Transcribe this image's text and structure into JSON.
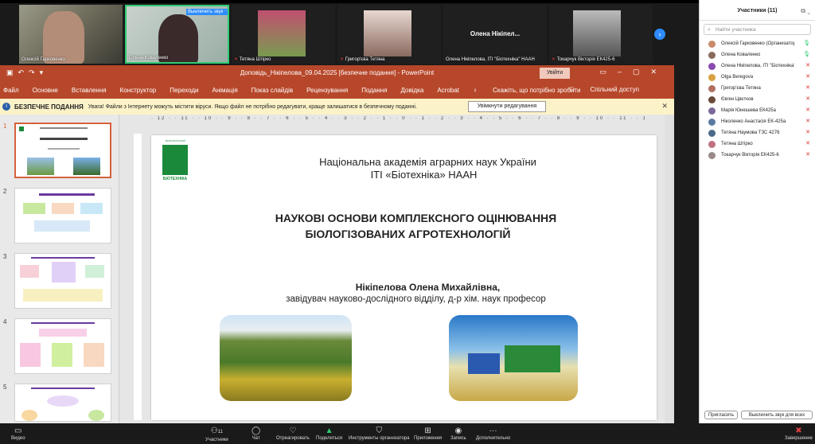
{
  "video_strip": {
    "tiles": [
      {
        "name": "Олексій Гарковенко",
        "muted": false
      },
      {
        "name": "Олена Коваленко",
        "badge": "Выключить звук",
        "muted": false
      },
      {
        "name": "Тетяна Штірко",
        "muted": true
      },
      {
        "name": "Григор'єва Тетяна",
        "muted": true
      },
      {
        "name": "Олена Нікіпелова, ІТІ \"Біотехніка\" НААН",
        "display": "Олена  Нікіпел...",
        "muted": false
      },
      {
        "name": "Токарчук Вікторія ЕК425-6",
        "muted": true
      }
    ],
    "next_icon": "chevron-right-icon"
  },
  "powerpoint": {
    "window_title": "Доповідь_Нікіпелова_09.04.2025 [безпечне подання] - PowerPoint",
    "sign_in": "Увійти",
    "ribbon_tabs": [
      "Файл",
      "Основне",
      "Вставлення",
      "Конструктор",
      "Переходи",
      "Анімація",
      "Показ слайдів",
      "Рецензування",
      "Подання",
      "Довідка",
      "Acrobat",
      "Скажіть, що потрібно зробити"
    ],
    "share": "Спільний доступ",
    "message_bar": {
      "title": "БЕЗПЕЧНЕ ПОДАННЯ",
      "text": "Увага! Файли з Інтернету можуть містити віруси. Якщо файл не потрібно редагувати, краще залишатися в безпечному поданні.",
      "button": "Увімкнути редагування"
    },
    "thumbnails": [
      "1",
      "2",
      "3",
      "4",
      "5"
    ],
    "ruler_numbers": "· 12 · · 11 · · 10 · · 9 · · 8 · · 7 · · 6 · · 5 · · 4 · · 3 · · 2 · · 1 · · 0 · · 1 · · 2 · · 3 · · 4 · · 5 · · 6 · · 7 · · 8 · · 9 · · 10 · · 11 · · 12 ·",
    "slide": {
      "logo_text": "ТЕХНОЛОГІЧНИЙ ІНСТИТУТ БІОТЕХНІКА",
      "org_line1": "Національна академія аграрних наук України",
      "org_line2": "ІТІ «Біотехніка» НААН",
      "title_line1": "НАУКОВІ ОСНОВИ КОМПЛЕКСНОГО ОЦІНЮВАННЯ",
      "title_line2": "БІОЛОГІЗОВАНИХ АГРОТЕХНОЛОГІЙ",
      "author": "Нікіпелова Олена Михайлівна,",
      "position": "завідувач науково-дослідного відділу, д-р хім. наук професор"
    }
  },
  "participants": {
    "title": "Участники (11)",
    "search_placeholder": "Найти участника",
    "list": [
      {
        "name": "Олексій Гарковенко (Организатор, я)",
        "color": "#c98a6a"
      },
      {
        "name": "Олена Коваленко",
        "color": "#8a6a5a"
      },
      {
        "name": "Олена Нікіпелова, ІТІ \"Біотехніка\" НААН",
        "color": "#8a4ab0"
      },
      {
        "name": "Olga Beregova",
        "color": "#d8a040"
      },
      {
        "name": "Григор'єва Тетяна",
        "color": "#b07060"
      },
      {
        "name": "Євген Цвєтков",
        "color": "#6a4a3a"
      },
      {
        "name": "Марія Юнюшева ЕК425а",
        "color": "#7a6a9a"
      },
      {
        "name": "Ніколенко Анастасія ЕК-425а",
        "color": "#5a7aa0"
      },
      {
        "name": "Тетяна Наумова ТЗС 4276",
        "color": "#4a6a8a"
      },
      {
        "name": "Тетяна Штірко",
        "color": "#c07080"
      },
      {
        "name": "Токарчук Вікторія ЕК425-6",
        "color": "#9a8a8a"
      }
    ],
    "invite": "Пригласить",
    "mute_all": "Выключить звук для всех"
  },
  "toolbar": {
    "video": "Видео",
    "participants": "Участники",
    "participants_count": "11",
    "chat": "Чат",
    "react": "Отреагировать",
    "share": "Поделиться",
    "host_tools": "Инструменты организатора",
    "apps": "Приложения",
    "record": "Запись",
    "more": "Дополнительно",
    "end": "Завершение"
  }
}
